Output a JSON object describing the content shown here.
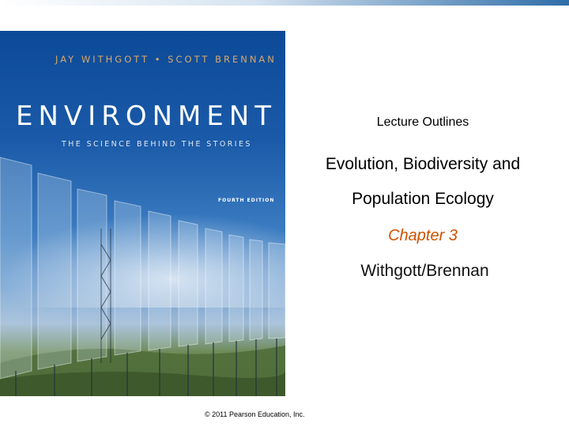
{
  "slide": {
    "lecture_label": "Lecture Outlines",
    "title_line1": "Evolution, Biodiversity and",
    "title_line2": "Population Ecology",
    "chapter": "Chapter  3",
    "authors": "Withgott/Brennan",
    "copyright": "© 2011 Pearson Education, Inc."
  },
  "cover": {
    "authors": "JAY WITHGOTT • SCOTT BRENNAN",
    "title": "ENVIRONMENT",
    "subtitle": "THE SCIENCE BEHIND THE STORIES",
    "edition": "FOURTH EDITION"
  },
  "colors": {
    "chapter_text": "#cc5200",
    "cover_blue": "#0c4a98",
    "top_bar_accent": "#2f6da8"
  }
}
